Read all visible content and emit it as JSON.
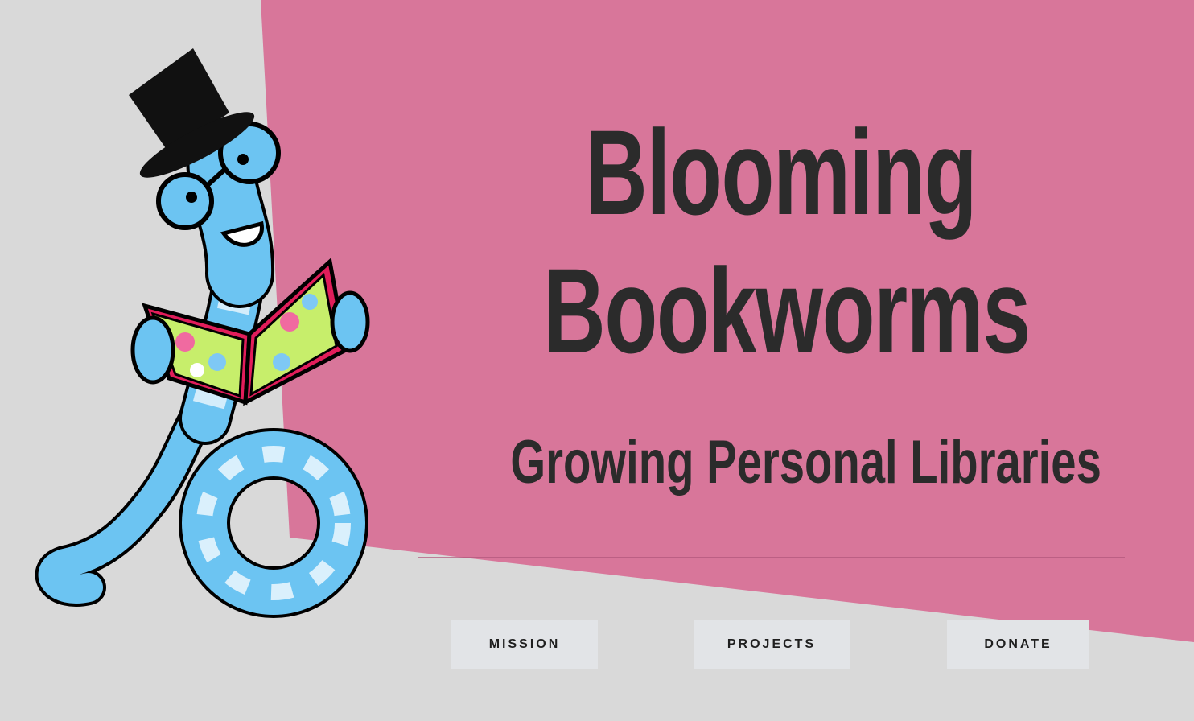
{
  "hero": {
    "title_line1": "Blooming",
    "title_line2": "Bookworms",
    "subtitle": "Growing Personal Libraries"
  },
  "nav": {
    "mission": "MISSION",
    "projects": "PROJECTS",
    "donate": "DONATE"
  },
  "colors": {
    "background": "#d9d9d9",
    "accent_pink": "#d8769a",
    "text": "#2b2b2b",
    "button_bg": "#e2e4e7",
    "worm_blue": "#6cc4f2"
  },
  "mascot": {
    "icon": "bookworm-mascot-icon"
  }
}
